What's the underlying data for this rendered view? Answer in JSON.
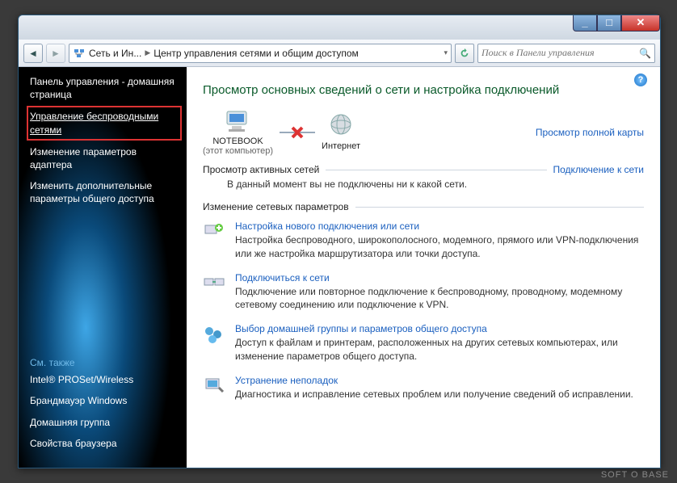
{
  "addressbar": {
    "seg1": "Сеть и Ин...",
    "seg2": "Центр управления сетями и общим доступом"
  },
  "search": {
    "placeholder": "Поиск в Панели управления"
  },
  "sidebar": {
    "home": "Панель управления - домашняя страница",
    "links": [
      "Управление беспроводными сетями",
      "Изменение параметров адаптера",
      "Изменить дополнительные параметры общего доступа"
    ],
    "see_also_hdr": "См. также",
    "see_also": [
      "Intel® PROSet/Wireless",
      "Брандмауэр Windows",
      "Домашняя группа",
      "Свойства браузера"
    ]
  },
  "main": {
    "title": "Просмотр основных сведений о сети и настройка подключений",
    "map_link": "Просмотр полной карты",
    "node_pc": "NOTEBOOK",
    "node_pc_sub": "(этот компьютер)",
    "node_net": "Интернет",
    "active_hdr": "Просмотр активных сетей",
    "connect_link": "Подключение к сети",
    "active_msg": "В данный момент вы не подключены ни к какой сети.",
    "change_hdr": "Изменение сетевых параметров",
    "items": [
      {
        "title": "Настройка нового подключения или сети",
        "desc": "Настройка беспроводного, широкополосного, модемного, прямого или VPN-подключения или же настройка маршрутизатора или точки доступа."
      },
      {
        "title": "Подключиться к сети",
        "desc": "Подключение или повторное подключение к беспроводному, проводному, модемному сетевому соединению или подключение к VPN."
      },
      {
        "title": "Выбор домашней группы и параметров общего доступа",
        "desc": "Доступ к файлам и принтерам, расположенных на других сетевых компьютерах, или изменение параметров общего доступа."
      },
      {
        "title": "Устранение неполадок",
        "desc": "Диагностика и исправление сетевых проблем или получение сведений об исправлении."
      }
    ]
  },
  "watermark": "SOFT O BASE"
}
